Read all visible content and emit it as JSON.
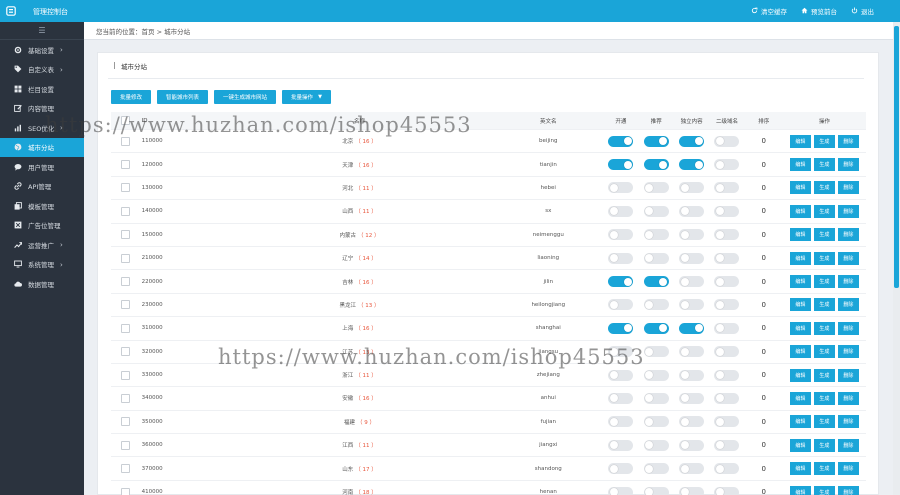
{
  "app": {
    "title": "管理控制台"
  },
  "top_actions": [
    {
      "icon": "refresh-icon",
      "label": "清空缓存"
    },
    {
      "icon": "home-icon",
      "label": "预览前台"
    },
    {
      "icon": "power-icon",
      "label": "退出"
    }
  ],
  "sidebar": {
    "toggle": "☰",
    "items": [
      {
        "icon": "gear-icon",
        "label": "基础设置",
        "chevron": true
      },
      {
        "icon": "tag-icon",
        "label": "自定义表",
        "chevron": true
      },
      {
        "icon": "grid-icon",
        "label": "栏目设置",
        "chevron": false
      },
      {
        "icon": "edit-icon",
        "label": "内容管理",
        "chevron": false
      },
      {
        "icon": "chart-icon",
        "label": "SEO优化",
        "chevron": true
      },
      {
        "icon": "globe-icon",
        "label": "城市分站",
        "chevron": false,
        "active": true
      },
      {
        "icon": "comment-icon",
        "label": "用户管理",
        "chevron": false
      },
      {
        "icon": "link-icon",
        "label": "API管理",
        "chevron": false
      },
      {
        "icon": "copy-icon",
        "label": "模板管理",
        "chevron": false
      },
      {
        "icon": "ad-icon",
        "label": "广告位管理",
        "chevron": false
      },
      {
        "icon": "share-icon",
        "label": "运营推广",
        "chevron": true
      },
      {
        "icon": "monitor-icon",
        "label": "系统管理",
        "chevron": true
      },
      {
        "icon": "cloud-icon",
        "label": "数据管理",
        "chevron": false
      }
    ]
  },
  "breadcrumb": "您当前的位置：首页 > 城市分站",
  "panel": {
    "title": "城市分站"
  },
  "toolbar": {
    "buttons": [
      "批量修改",
      "智能城市列表",
      "一键生成城市网站",
      "批量操作"
    ]
  },
  "table": {
    "headers": {
      "id": "ID",
      "name": "名称",
      "en": "英文名",
      "open": "开通",
      "rec": "推荐",
      "solo": "独立内容",
      "sub": "二级域名",
      "sort": "排序",
      "op": "操作"
    },
    "op_labels": [
      "编辑",
      "生成",
      "删除"
    ],
    "rows": [
      {
        "id": "110000",
        "name": "北京",
        "count": "（ 16 ）",
        "en": "beijing",
        "open": true,
        "rec": true,
        "solo": true,
        "sub": false,
        "sort": "0"
      },
      {
        "id": "120000",
        "name": "天津",
        "count": "（ 16 ）",
        "en": "tianjin",
        "open": true,
        "rec": true,
        "solo": true,
        "sub": false,
        "sort": "0"
      },
      {
        "id": "130000",
        "name": "河北",
        "count": "（ 11 ）",
        "en": "hebei",
        "open": false,
        "rec": false,
        "solo": false,
        "sub": false,
        "sort": "0"
      },
      {
        "id": "140000",
        "name": "山西",
        "count": "（ 11 ）",
        "en": "sx",
        "open": false,
        "rec": false,
        "solo": false,
        "sub": false,
        "sort": "0"
      },
      {
        "id": "150000",
        "name": "内蒙古",
        "count": "（ 12 ）",
        "en": "neimenggu",
        "open": false,
        "rec": false,
        "solo": false,
        "sub": false,
        "sort": "0"
      },
      {
        "id": "210000",
        "name": "辽宁",
        "count": "（ 14 ）",
        "en": "liaoning",
        "open": false,
        "rec": false,
        "solo": false,
        "sub": false,
        "sort": "0"
      },
      {
        "id": "220000",
        "name": "吉林",
        "count": "（ 16 ）",
        "en": "jilin",
        "open": true,
        "rec": true,
        "solo": false,
        "sub": false,
        "sort": "0"
      },
      {
        "id": "230000",
        "name": "黑龙江",
        "count": "（ 13 ）",
        "en": "heilongjiang",
        "open": false,
        "rec": false,
        "solo": false,
        "sub": false,
        "sort": "0"
      },
      {
        "id": "310000",
        "name": "上海",
        "count": "（ 16 ）",
        "en": "shanghai",
        "open": true,
        "rec": true,
        "solo": true,
        "sub": false,
        "sort": "0"
      },
      {
        "id": "320000",
        "name": "江苏",
        "count": "（ 13 ）",
        "en": "jiangsu",
        "open": false,
        "rec": false,
        "solo": false,
        "sub": false,
        "sort": "0"
      },
      {
        "id": "330000",
        "name": "浙江",
        "count": "（ 11 ）",
        "en": "zhejiang",
        "open": false,
        "rec": false,
        "solo": false,
        "sub": false,
        "sort": "0"
      },
      {
        "id": "340000",
        "name": "安徽",
        "count": "（ 16 ）",
        "en": "anhui",
        "open": false,
        "rec": false,
        "solo": false,
        "sub": false,
        "sort": "0"
      },
      {
        "id": "350000",
        "name": "福建",
        "count": "（ 9 ）",
        "en": "fujian",
        "open": false,
        "rec": false,
        "solo": false,
        "sub": false,
        "sort": "0"
      },
      {
        "id": "360000",
        "name": "江西",
        "count": "（ 11 ）",
        "en": "jiangxi",
        "open": false,
        "rec": false,
        "solo": false,
        "sub": false,
        "sort": "0"
      },
      {
        "id": "370000",
        "name": "山东",
        "count": "（ 17 ）",
        "en": "shandong",
        "open": false,
        "rec": false,
        "solo": false,
        "sub": false,
        "sort": "0"
      },
      {
        "id": "410000",
        "name": "河南",
        "count": "（ 18 ）",
        "en": "henan",
        "open": false,
        "rec": false,
        "solo": false,
        "sub": false,
        "sort": "0"
      }
    ]
  },
  "watermark": "https://www.huzhan.com/ishop45553",
  "colors": {
    "accent": "#1aa5d8",
    "sidebar_bg": "#2b333e",
    "count_red": "#e8553b"
  }
}
